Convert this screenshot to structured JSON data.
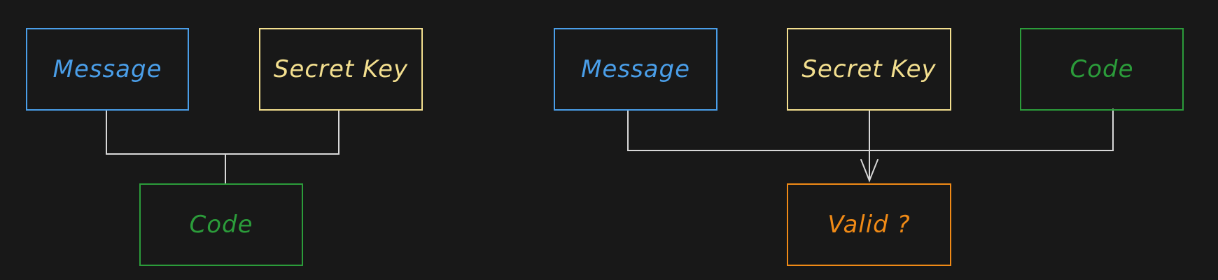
{
  "colors": {
    "background": "#181818",
    "message": "#4a9ee8",
    "secret_key": "#f3df8f",
    "code": "#2b9c3a",
    "valid": "#f08a16",
    "connector": "#d8d8d8"
  },
  "diagram_left": {
    "message": "Message",
    "secret_key": "Secret Key",
    "code": "Code"
  },
  "diagram_right": {
    "message": "Message",
    "secret_key": "Secret Key",
    "code": "Code",
    "valid": "Valid ?"
  }
}
